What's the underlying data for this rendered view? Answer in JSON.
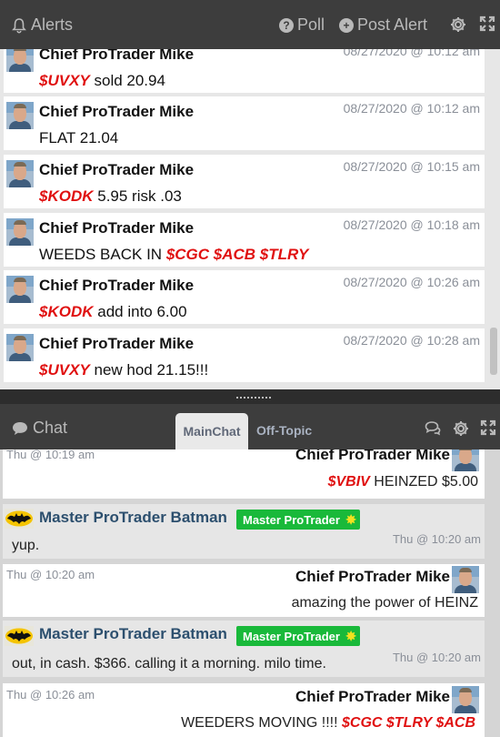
{
  "alerts": {
    "title": "Alerts",
    "poll_label": "Poll",
    "post_alert_label": "Post Alert",
    "items": [
      {
        "name": "Chief ProTrader Mike",
        "time": "08/27/2020 @ 10:12 am",
        "ticker": "$UVXY",
        "text": "sold 20.94"
      },
      {
        "name": "Chief ProTrader Mike",
        "time": "08/27/2020 @ 10:12 am",
        "ticker": "",
        "text": "FLAT 21.04"
      },
      {
        "name": "Chief ProTrader Mike",
        "time": "08/27/2020 @ 10:15 am",
        "ticker": "$KODK",
        "text": "5.95 risk .03"
      },
      {
        "name": "Chief ProTrader Mike",
        "time": "08/27/2020 @ 10:18 am",
        "prefix": "WEEDS BACK IN",
        "ticker": "$CGC $ACB $TLRY",
        "text": ""
      },
      {
        "name": "Chief ProTrader Mike",
        "time": "08/27/2020 @ 10:26 am",
        "ticker": "$KODK",
        "text": "add into 6.00"
      },
      {
        "name": "Chief ProTrader Mike",
        "time": "08/27/2020 @ 10:28 am",
        "ticker": "$UVXY",
        "text": "new hod 21.15!!!"
      }
    ]
  },
  "chat": {
    "title": "Chat",
    "tabs": [
      "MainChat",
      "Off-Topic"
    ],
    "messages": [
      {
        "time": "Thu @ 10:19 am",
        "name": "Chief ProTrader Mike",
        "ticker": "$VBIV",
        "text": "HEINZED $5.00"
      },
      {
        "name": "Master ProTrader Batman",
        "badge": "Master ProTrader",
        "text": "yup.",
        "time": "Thu @ 10:20 am"
      },
      {
        "time": "Thu @ 10:20 am",
        "name": "Chief ProTrader Mike",
        "text": "amazing the power of HEINZ"
      },
      {
        "name": "Master ProTrader Batman",
        "badge": "Master ProTrader",
        "text": "out, in cash.  $366.  calling it a morning.  milo time.",
        "time": "Thu @ 10:20 am"
      },
      {
        "time": "Thu @ 10:26 am",
        "name": "Chief ProTrader Mike",
        "prefix": "WEEDERS MOVING !!!!",
        "ticker": "$CGC $TLRY $ACB"
      }
    ]
  },
  "colors": {
    "ticker": "#e01010",
    "badge": "#19b93a",
    "header": "#3d3d3d"
  },
  "icons": [
    "bell-icon",
    "question-circle-icon",
    "plus-circle-icon",
    "gear-icon",
    "expand-icon",
    "chat-bubble-icon"
  ]
}
